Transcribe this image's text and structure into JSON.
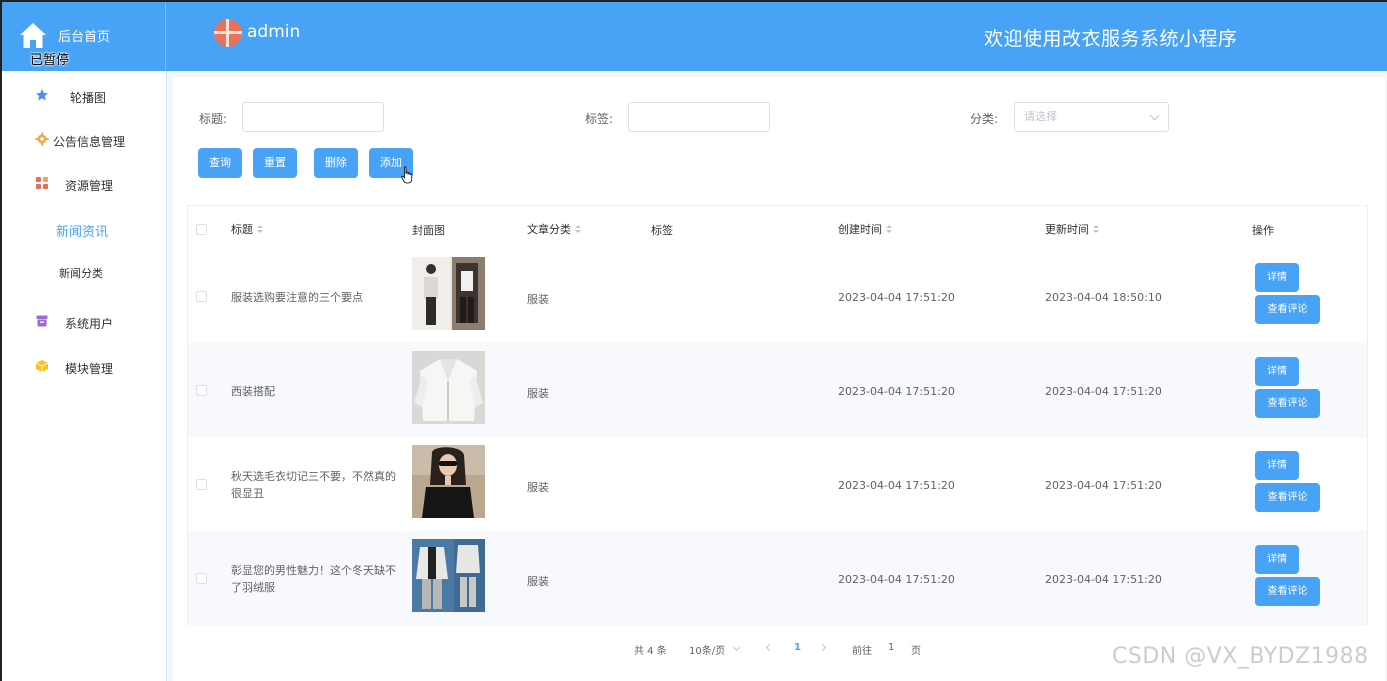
{
  "header": {
    "home_label": "后台首页",
    "paused_label": "已暂停",
    "user_name": "admin",
    "app_title": "欢迎使用改衣服务系统小程序"
  },
  "sidebar": {
    "items": [
      {
        "label": "轮播图",
        "icon": "star-icon",
        "color": "#4a8ef0"
      },
      {
        "label": "公告信息管理",
        "icon": "gear-icon",
        "color": "#f2a54a"
      },
      {
        "label": "资源管理",
        "icon": "grid-icon",
        "color": "#ea6b57"
      },
      {
        "label": "新闻资讯",
        "active": true
      },
      {
        "label": "新闻分类"
      },
      {
        "label": "系统用户",
        "icon": "archive-icon",
        "color": "#9b6ccf"
      },
      {
        "label": "模块管理",
        "icon": "cube-icon",
        "color": "#f4c325"
      }
    ]
  },
  "filters": {
    "title_label": "标题:",
    "tag_label": "标签:",
    "category_label": "分类:",
    "category_placeholder": "请选择"
  },
  "actions": {
    "query": "查询",
    "reset": "重置",
    "delete": "删除",
    "add": "添加"
  },
  "table": {
    "columns": [
      "标题",
      "封面图",
      "文章分类",
      "标签",
      "创建时间",
      "更新时间",
      "操作"
    ],
    "rows": [
      {
        "title": "服装选购要注意的三个要点",
        "category": "服装",
        "tag": "",
        "created": "2023-04-04 17:51:20",
        "updated": "2023-04-04 18:50:10",
        "thumb": "cover-photo-1"
      },
      {
        "title": "西装搭配",
        "category": "服装",
        "tag": "",
        "created": "2023-04-04 17:51:20",
        "updated": "2023-04-04 17:51:20",
        "thumb": "cover-photo-2"
      },
      {
        "title": "秋天选毛衣切记三不要，不然真的很显丑",
        "category": "服装",
        "tag": "",
        "created": "2023-04-04 17:51:20",
        "updated": "2023-04-04 17:51:20",
        "thumb": "cover-photo-3"
      },
      {
        "title": "彰显您的男性魅力！这个冬天缺不了羽绒服",
        "category": "服装",
        "tag": "",
        "created": "2023-04-04 17:51:20",
        "updated": "2023-04-04 17:51:20",
        "thumb": "cover-photo-4"
      }
    ],
    "row_actions": {
      "detail": "详情",
      "comments": "查看评论"
    }
  },
  "pagination": {
    "total": "共 4 条",
    "page_size": "10条/页",
    "current_page": "1",
    "goto_label": "前往",
    "goto_value": "1",
    "page_unit": "页"
  },
  "watermark": "CSDN @VX_BYDZ1988",
  "colors": {
    "accent": "#48a3f6",
    "topbar": "#48a3f6"
  }
}
